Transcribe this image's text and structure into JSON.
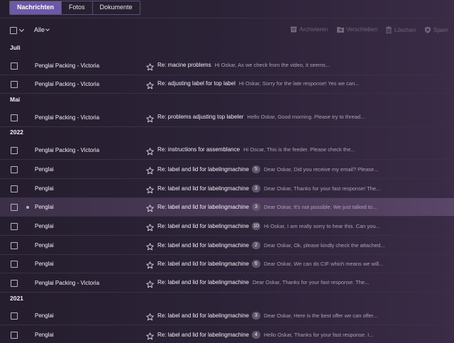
{
  "tabs": [
    {
      "label": "Nachrichten",
      "active": true
    },
    {
      "label": "Fotos",
      "active": false
    },
    {
      "label": "Dokumente",
      "active": false
    }
  ],
  "toolbar": {
    "filter_label": "Alle",
    "actions": {
      "archive": "Archivieren",
      "move": "Verschieben",
      "delete": "Löschen",
      "spam": "Spam"
    }
  },
  "sections": [
    {
      "label": "Juli"
    },
    {
      "label": "Mai"
    },
    {
      "label": "2022"
    },
    {
      "label": "2021"
    }
  ],
  "emails": [
    {
      "sender": "Penglai Packing - Victoria",
      "subject": "Re: macine problems",
      "count": "",
      "snippet": "Hi Oskar, As we check from the video, it seems...",
      "highlighted": false
    },
    {
      "sender": "Penglai Packing - Victoria",
      "subject": "Re: adjusting label for top label",
      "count": "",
      "snippet": "Hi Oskar, Sorry for the late response! Yes we can...",
      "highlighted": false
    },
    {
      "sender": "Penglai Packing - Victoria",
      "subject": "Re: problems adjusting top labeler",
      "count": "",
      "snippet": "Hello Oskar, Good morning. Please try to thread...",
      "highlighted": false
    },
    {
      "sender": "Penglai Packing - Victoria",
      "subject": "Re: instructions for assemblance",
      "count": "",
      "snippet": "Hi Oscar, This is the feeder. Please check the...",
      "highlighted": false
    },
    {
      "sender": "Penglai",
      "subject": "Re: label and lid for labelingmachine",
      "count": "5",
      "snippet": "Dear Oskar, Did you receive my email? Please...",
      "highlighted": false
    },
    {
      "sender": "Penglai",
      "subject": "Re: label and lid for labelingmachine",
      "count": "3",
      "snippet": "Dear Oskar, Thanks for your fast response! The...",
      "highlighted": false
    },
    {
      "sender": "Penglai",
      "subject": "Re: label and lid for labelingmachine",
      "count": "3",
      "snippet": "Dear Oskar, It's not possible. We just talked to...",
      "highlighted": true
    },
    {
      "sender": "Penglai",
      "subject": "Re: label and lid for labelingmachine",
      "count": "10",
      "snippet": "Hi Oskar,   I am really sorry to hear this. Can you...",
      "highlighted": false
    },
    {
      "sender": "Penglai",
      "subject": "Re: label and lid for labelingmachine",
      "count": "2",
      "snippet": "Dear Oskar, Ok, please kindly check the attached...",
      "highlighted": false
    },
    {
      "sender": "Penglai",
      "subject": "Re: label and lid for labelingmachine",
      "count": "6",
      "snippet": "Dear Oskar, We can do CIF which means we will...",
      "highlighted": false
    },
    {
      "sender": "Penglai Packing - Victoria",
      "subject": "Re: label and lid for labelingmachine",
      "count": "",
      "snippet": "Dear Oskar, Thanks for your fast response. The...",
      "highlighted": false
    },
    {
      "sender": "Penglai",
      "subject": "Re: label and lid for labelingmachine",
      "count": "3",
      "snippet": "Dear Oskar, Here is the best offer we can offer...",
      "highlighted": false
    },
    {
      "sender": "Penglai",
      "subject": "Re: label and lid for labelingmachine",
      "count": "4",
      "snippet": "Hello Oskar, Thanks for your fast response. I...",
      "highlighted": false
    }
  ]
}
